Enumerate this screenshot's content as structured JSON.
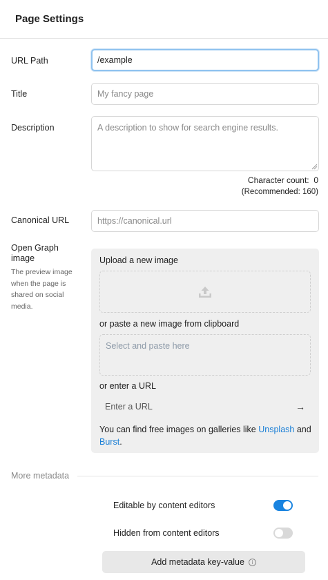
{
  "header": {
    "title": "Page Settings"
  },
  "url_path": {
    "label": "URL Path",
    "value": "/example"
  },
  "title_field": {
    "label": "Title",
    "placeholder": "My fancy page"
  },
  "description": {
    "label": "Description",
    "placeholder": "A description to show for search engine results.",
    "char_count_label": "Character count:",
    "char_count": "0",
    "recommended": "(Recommended: 160)"
  },
  "canonical": {
    "label": "Canonical URL",
    "placeholder": "https://canonical.url"
  },
  "open_graph": {
    "label": "Open Graph image",
    "description": "The preview image when the page is shared on social media.",
    "upload_label": "Upload a new image",
    "upload_icon": "upload-icon",
    "paste_label": "or paste a new image from clipboard",
    "paste_placeholder": "Select and paste here",
    "url_label": "or enter a URL",
    "url_placeholder": "Enter a URL",
    "hint_prefix": "You can find free images on galleries like",
    "link_unsplash": "Unsplash",
    "hint_and": "and",
    "link_burst": "Burst",
    "hint_suffix": "."
  },
  "more_metadata": {
    "label": "More metadata",
    "editable_label": "Editable by content editors",
    "editable_on": true,
    "hidden_label": "Hidden from content editors",
    "hidden_on": false,
    "add_button": "Add metadata key-value"
  },
  "colors": {
    "accent": "#1a84e0",
    "link": "#1a7fd6",
    "focus_ring": "#8fc2ef",
    "panel_bg": "#efefef"
  }
}
